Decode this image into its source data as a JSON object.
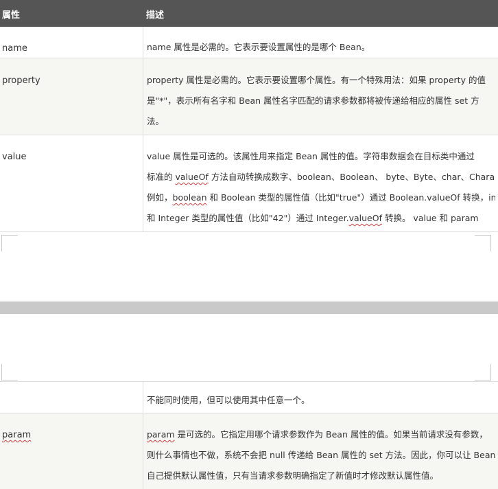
{
  "header": {
    "col1": "属性",
    "col2": "描述"
  },
  "rows": {
    "name": {
      "label": "name",
      "lines": [
        "name 属性是必需的。它表示要设置属性的是哪个 Bean。"
      ]
    },
    "property": {
      "label": "property",
      "lines": [
        "property 属性是必需的。它表示要设置哪个属性。有一个特殊用法：如果 property 的值",
        "是\"*\"，表示所有名字和 Bean 属性名字匹配的请求参数都将被传递给相应的属性 set 方",
        "法。"
      ]
    },
    "value": {
      "label": "value",
      "lines": [
        "value  属性是可选的。该属性用来指定 Bean 属性的值。字符串数据会在目标类中通过",
        {
          "pre": "标准的 ",
          "sq": "valueOf",
          "post": " 方法自动转换成数字、boolean、Boolean、 byte、Byte、char、Character。"
        },
        {
          "pre": "例如，",
          "sq": "boolean",
          "post": " 和 Boolean 类型的属性值（比如\"true\"）通过  Boolean.valueOf 转换，int"
        },
        {
          "pre": "和 Integer 类型的属性值（比如\"42\"）通过 Integer.",
          "sq": "valueOf",
          "post": " 转换。          value 和 param"
        }
      ]
    },
    "continued": {
      "label": "",
      "lines": [
        "不能同时使用，但可以使用其中任意一个。"
      ]
    },
    "param": {
      "label": "param",
      "lines": [
        {
          "pre": "",
          "sq": "param",
          "post": "  是可选的。它指定用哪个请求参数作为 Bean 属性的值。如果当前请求没有参数，"
        },
        "则什么事情也不做，系统不会把 null 传递给 Bean 属性的 set 方法。因此，你可以让 Bean",
        "自己提供默认属性值，只有当请求参数明确指定了新值时才修改默认属性值。"
      ]
    }
  }
}
